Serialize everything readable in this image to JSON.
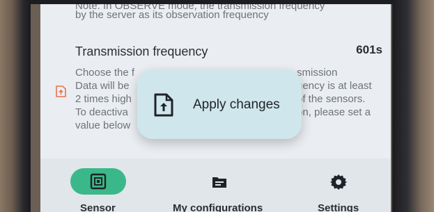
{
  "settings": {
    "note_cut": "Note: In OBSERVE mode, the transmission frequency",
    "note_line": "by the server as its observation frequency",
    "transmission": {
      "title": "Transmission frequency",
      "value": "601s",
      "description_lines": [
        "Choose the f",
        "Data will be",
        "2 times high",
        "To deactiva",
        "value below"
      ],
      "description_right_lines": [
        "smission",
        "uency is at least",
        "of the sensors.",
        "on, please set a"
      ]
    }
  },
  "toast": {
    "label": "Apply changes",
    "icon": "file-upload-icon"
  },
  "bottom_nav": {
    "items": [
      {
        "label": "Sensor",
        "icon": "sensor-icon",
        "active": true
      },
      {
        "label": "My configurations",
        "icon": "folder-icon",
        "active": false
      },
      {
        "label": "Settings",
        "icon": "gear-icon",
        "active": false
      }
    ]
  },
  "colors": {
    "accent": "#3bb88a",
    "toast_bg": "#cfe6ec",
    "warning_icon": "#e8734a"
  }
}
